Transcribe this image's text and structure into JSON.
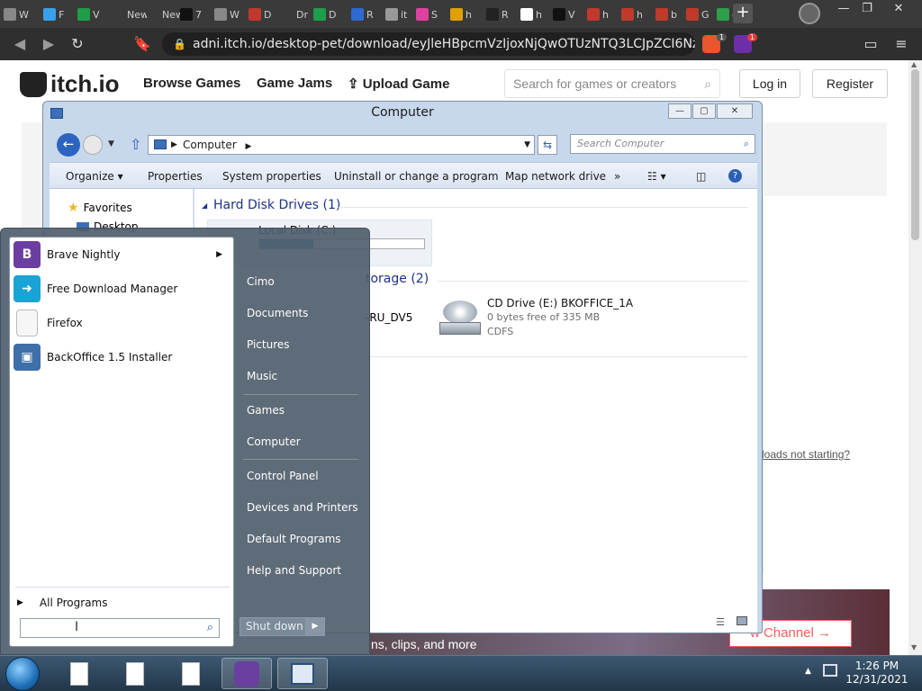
{
  "browser": {
    "tabs": [
      {
        "label": "W",
        "color": "#888888"
      },
      {
        "label": "F",
        "color": "#3aa0e8"
      },
      {
        "label": "V",
        "color": "#1e9e4a"
      },
      {
        "label": "New",
        "color": "#3a3a3a"
      },
      {
        "label": "New",
        "color": "#3a3a3a"
      },
      {
        "label": "7",
        "color": "#111111"
      },
      {
        "label": "W",
        "color": "#888888"
      },
      {
        "label": "D",
        "color": "#c0392b"
      },
      {
        "label": "Dr",
        "color": "#3a3a3a"
      },
      {
        "label": "D",
        "color": "#1e9e4a"
      },
      {
        "label": "R",
        "color": "#2e6ad1"
      },
      {
        "label": "it",
        "color": "#999999"
      },
      {
        "label": "S",
        "color": "#e040a0"
      },
      {
        "label": "h",
        "color": "#e0a000"
      },
      {
        "label": "R",
        "color": "#222222"
      },
      {
        "label": "h",
        "color": "#ffffff"
      },
      {
        "label": "V",
        "color": "#111111"
      },
      {
        "label": "h",
        "color": "#c0392b"
      },
      {
        "label": "h",
        "color": "#c0392b"
      },
      {
        "label": "b",
        "color": "#c0392b"
      },
      {
        "label": "G",
        "color": "#c0392b"
      },
      {
        "label": "g",
        "color": "#2e9e4a"
      }
    ],
    "new_tab": "+",
    "window_controls": {
      "minimize": "—",
      "restore": "❐",
      "close": "✕"
    },
    "url": "adni.itch.io/desktop-pet/download/eyJleHBpcmVzIjoxNjQwOTUzNTQ3LCJpZCI6NzI4Nz...",
    "extension_badge": "1",
    "notification_badge": "1"
  },
  "site": {
    "logo": "itch.io",
    "nav": [
      "Browse Games",
      "Game Jams",
      "Upload Game"
    ],
    "search_placeholder": "Search for games or creators",
    "login": "Log in",
    "register": "Register",
    "help_link": "loads not starting?",
    "video_caption": "ns, clips, and more",
    "follow": "w Channel →"
  },
  "explorer": {
    "title": "Computer",
    "address": "Computer",
    "search_placeholder": "Search Computer",
    "commands": [
      "Organize ▾",
      "Properties",
      "System properties",
      "Uninstall or change a program",
      "Map network drive",
      "»"
    ],
    "nav_favorites": "Favorites",
    "nav_desktop": "Desktop",
    "groups": {
      "hdd": "Hard Disk Drives (1)",
      "removable": "torage (2)"
    },
    "drives": {
      "local_label": "Local Disk (C:)",
      "dvd_label": "-RU_DV5",
      "cd_name": "CD Drive (E:) BKOFFICE_1A",
      "cd_free": "0 bytes free of 335 MB",
      "cd_fs": "CDFS"
    }
  },
  "start_menu": {
    "pinned": [
      {
        "label": "Brave Nightly",
        "color": "#6b3fa0",
        "has_arrow": true
      },
      {
        "label": "Free Download Manager",
        "color": "#1aa3d6",
        "has_arrow": false
      },
      {
        "label": "Firefox",
        "color": "#f2f2f2",
        "has_arrow": false
      },
      {
        "label": "BackOffice 1.5 Installer",
        "color": "#3e6fa8",
        "has_arrow": false
      }
    ],
    "all_programs": "All Programs",
    "right_items": [
      "Cimo",
      "Documents",
      "Pictures",
      "Music",
      "Games",
      "Computer",
      "Control Panel",
      "Devices and Printers",
      "Default Programs",
      "Help and Support"
    ],
    "shutdown": "Shut down"
  },
  "taskbar": {
    "time": "1:26 PM",
    "date": "12/31/2021"
  }
}
